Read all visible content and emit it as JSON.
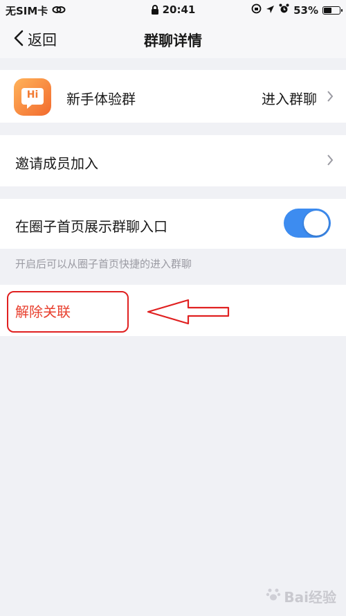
{
  "status_bar": {
    "carrier": "无SIM卡",
    "time": "20:41",
    "battery": "53%",
    "battery_level": 0.53
  },
  "nav": {
    "back_label": "返回",
    "title": "群聊详情"
  },
  "group": {
    "avatar_text": "Hi",
    "name": "新手体验群",
    "enter_label": "进入群聊"
  },
  "invite": {
    "label": "邀请成员加入"
  },
  "show_entry": {
    "label": "在圈子首页展示群聊入口",
    "enabled": true,
    "hint": "开启后可以从圈子首页快捷的进入群聊"
  },
  "unlink": {
    "label": "解除关联"
  },
  "watermark": {
    "text": "Bai经验"
  },
  "colors": {
    "accent_blue": "#3d8cf0",
    "danger_red": "#e8402f",
    "annotation_red": "#e02020",
    "background": "#f0f1f5"
  }
}
